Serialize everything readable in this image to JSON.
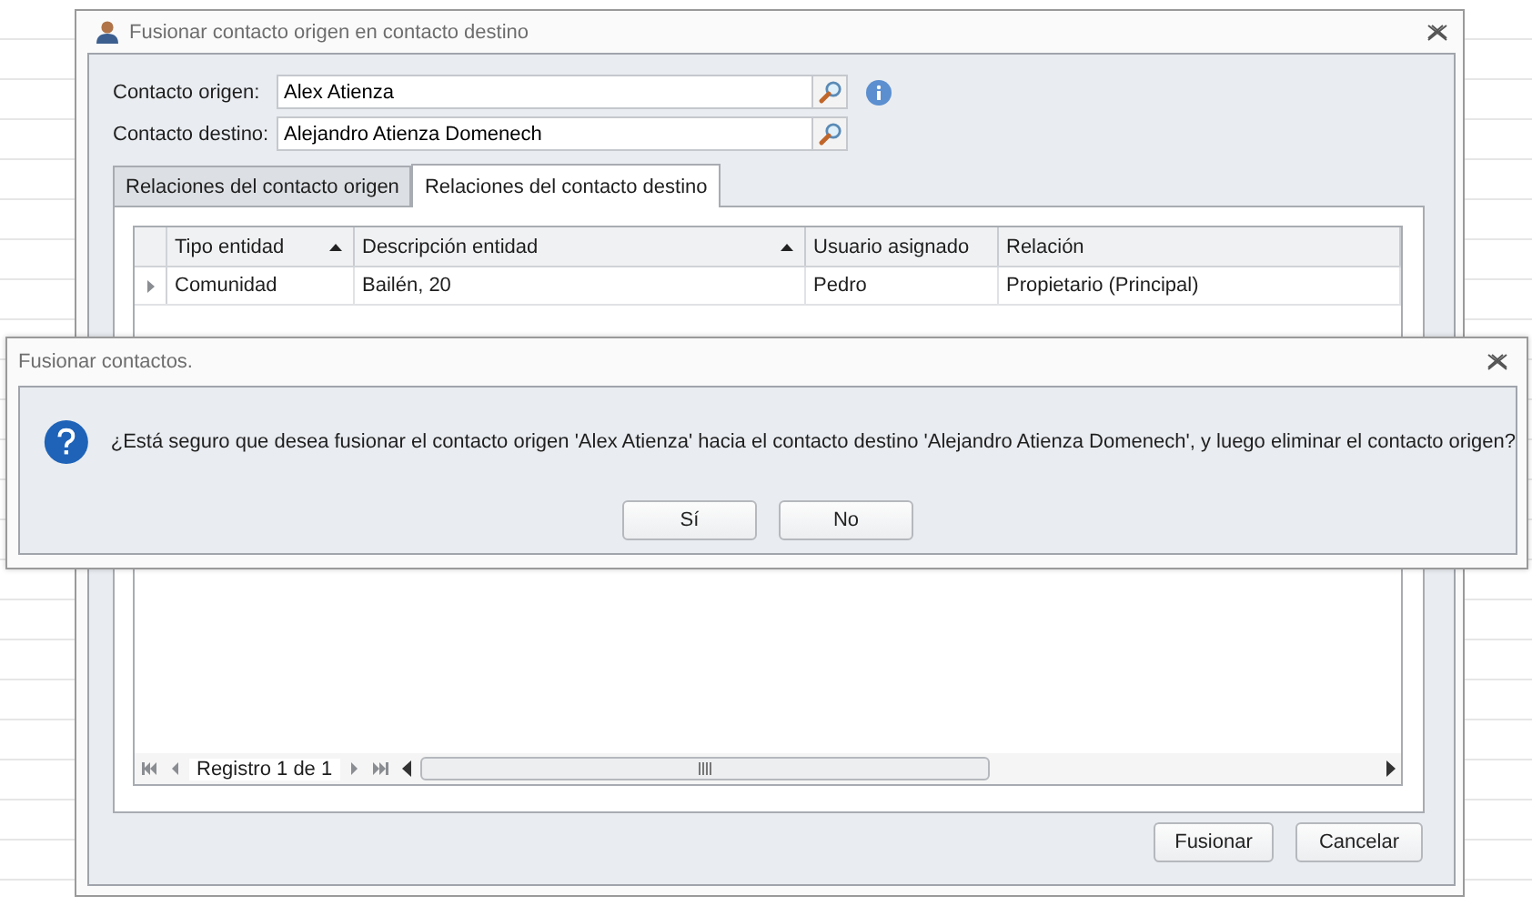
{
  "window": {
    "title": "Fusionar contacto origen en contacto destino"
  },
  "fields": [
    {
      "label": "Contacto origen:",
      "value": "Alex Atienza",
      "info": true
    },
    {
      "label": "Contacto destino:",
      "value": "Alejandro Atienza Domenech",
      "info": false
    }
  ],
  "tabs": [
    {
      "label": "Relaciones del contacto origen",
      "selected": false
    },
    {
      "label": "Relaciones del contacto destino",
      "selected": true
    }
  ],
  "table": {
    "columns": [
      {
        "label": "Tipo entidad",
        "sorted": true
      },
      {
        "label": "Descripción entidad",
        "sorted": true
      },
      {
        "label": "Usuario asignado",
        "sorted": false
      },
      {
        "label": "Relación",
        "sorted": false
      }
    ],
    "rows": [
      {
        "current": true,
        "cells": [
          "Comunidad",
          "Bailén, 20",
          "Pedro",
          "Propietario (Principal)"
        ]
      }
    ]
  },
  "navigator": {
    "text": "Registro 1 de 1"
  },
  "buttons": [
    "Fusionar",
    "Cancelar"
  ],
  "dialog": {
    "title": "Fusionar contactos.",
    "message": "¿Está seguro que desea fusionar el contacto origen 'Alex Atienza' hacia el contacto destino 'Alejandro Atienza Domenech', y luego eliminar el contacto origen?",
    "buttons": [
      "Sí",
      "No"
    ]
  }
}
